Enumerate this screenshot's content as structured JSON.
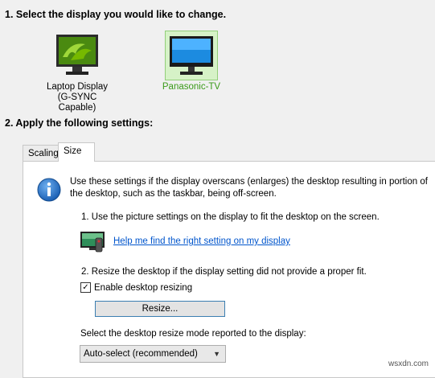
{
  "headings": {
    "select_display": "1. Select the display you would like to change.",
    "apply_settings": "2. Apply the following settings:"
  },
  "displays": [
    {
      "line1": "Laptop Display",
      "line2": "(G-SYNC Capable)",
      "icon": "laptop-monitor-icon",
      "selected": false
    },
    {
      "line1": "Panasonic-TV",
      "line2": "",
      "icon": "tv-monitor-icon",
      "selected": true
    }
  ],
  "tabs": [
    {
      "label": "Scaling",
      "active": false
    },
    {
      "label": "Size",
      "active": true
    }
  ],
  "panel": {
    "intro": "Use these settings if the display overscans (enlarges) the desktop resulting in portion of the desktop, such as the taskbar, being off-screen.",
    "step1": "1. Use the picture settings on the display to fit the desktop on the screen.",
    "help_link": "Help me find the right setting on my display",
    "step2": "2. Resize the desktop if the display setting did not provide a proper fit.",
    "enable_resizing_label": "Enable desktop resizing",
    "enable_resizing_checked": true,
    "resize_button": "Resize...",
    "mode_label": "Select the desktop resize mode reported to the display:",
    "mode_value": "Auto-select (recommended)"
  },
  "watermark": "wsxdn.com",
  "colors": {
    "selected_tile_bg": "#d6f2c7",
    "selected_label": "#3a9a19",
    "link": "#0055cc",
    "nvidia_green": "#76b900"
  }
}
